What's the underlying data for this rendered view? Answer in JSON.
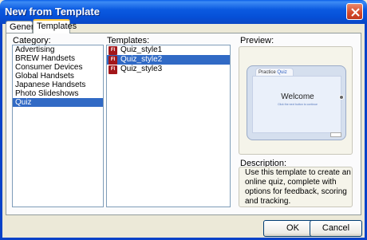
{
  "window": {
    "title": "New from Template"
  },
  "tabs": [
    {
      "label": "General"
    },
    {
      "label": "Templates"
    }
  ],
  "category": {
    "label": "Category:",
    "items": [
      {
        "label": "Advertising"
      },
      {
        "label": "BREW Handsets"
      },
      {
        "label": "Consumer Devices"
      },
      {
        "label": "Global Handsets"
      },
      {
        "label": "Japanese Handsets"
      },
      {
        "label": "Photo Slideshows"
      },
      {
        "label": "Quiz"
      }
    ],
    "selected": "Quiz"
  },
  "templates": {
    "label": "Templates:",
    "items": [
      {
        "label": "Quiz_style1",
        "icon": "fl"
      },
      {
        "label": "Quiz_style2",
        "icon": "fl"
      },
      {
        "label": "Quiz_style3",
        "icon": "fl"
      }
    ],
    "selected": "Quiz_style2"
  },
  "preview": {
    "label": "Preview:",
    "tab_prefix": "Practice",
    "tab_word": "Quiz",
    "welcome": "Welcome",
    "subtitle": "Click the next button to continue"
  },
  "description": {
    "label": "Description:",
    "text": "Use this template to create an online quiz, complete with options for feedback, scoring and tracking."
  },
  "buttons": {
    "ok": "OK",
    "cancel": "Cancel"
  },
  "colors": {
    "titlebar": "#0650d8",
    "selection": "#316ac5",
    "close": "#d3482a"
  }
}
